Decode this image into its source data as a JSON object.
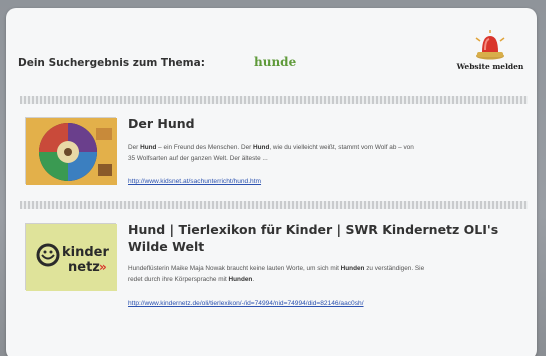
{
  "header": {
    "label": "Dein Suchergebnis zum Thema:",
    "query": "hunde",
    "report_button": "Website melden"
  },
  "results": [
    {
      "title": "Der Hund",
      "snippet_parts": [
        {
          "t": "Der ",
          "b": false
        },
        {
          "t": "Hund",
          "b": true
        },
        {
          "t": " – ein Freund des Menschen. Der ",
          "b": false
        },
        {
          "t": "Hund",
          "b": true
        },
        {
          "t": ", wie du vielleicht weißt, stammt vom Wolf ab – von 35 Wolfsarten auf der ganzen Welt. Der älteste ...",
          "b": false
        }
      ],
      "url": "http://www.kidsnet.at/sachunterricht/hund.htm"
    },
    {
      "title_line1": "Hund | Tierlexikon für Kinder | SWR Kindernetz OLI's",
      "title_line2": "Wilde Welt",
      "snippet_parts": [
        {
          "t": "Hundeflüsterin Maike Maja Nowak braucht keine lauten Worte, um sich mit ",
          "b": false
        },
        {
          "t": "Hunden",
          "b": true
        },
        {
          "t": " zu verständigen. Sie redet durch ihre Körpersprache mit ",
          "b": false
        },
        {
          "t": "Hunden",
          "b": true
        },
        {
          "t": ".",
          "b": false
        }
      ],
      "url": "http://www.kindernetz.de/oli/tierlexikon/-/id=74994/nid=74994/did=82146/aac0sh/",
      "logo_text_1": "kinder",
      "logo_text_2": "netz"
    }
  ],
  "colors": {
    "query": "#5f9a3a",
    "link": "#2c52b0",
    "siren": "#d9342b"
  }
}
